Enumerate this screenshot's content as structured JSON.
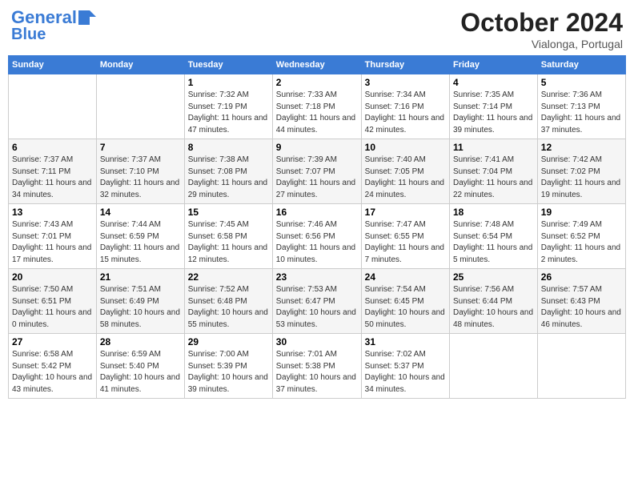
{
  "header": {
    "logo_line1": "General",
    "logo_line2": "Blue",
    "month": "October 2024",
    "location": "Vialonga, Portugal"
  },
  "days_of_week": [
    "Sunday",
    "Monday",
    "Tuesday",
    "Wednesday",
    "Thursday",
    "Friday",
    "Saturday"
  ],
  "weeks": [
    [
      {
        "day": "",
        "sunrise": "",
        "sunset": "",
        "daylight": ""
      },
      {
        "day": "",
        "sunrise": "",
        "sunset": "",
        "daylight": ""
      },
      {
        "day": "1",
        "sunrise": "Sunrise: 7:32 AM",
        "sunset": "Sunset: 7:19 PM",
        "daylight": "Daylight: 11 hours and 47 minutes."
      },
      {
        "day": "2",
        "sunrise": "Sunrise: 7:33 AM",
        "sunset": "Sunset: 7:18 PM",
        "daylight": "Daylight: 11 hours and 44 minutes."
      },
      {
        "day": "3",
        "sunrise": "Sunrise: 7:34 AM",
        "sunset": "Sunset: 7:16 PM",
        "daylight": "Daylight: 11 hours and 42 minutes."
      },
      {
        "day": "4",
        "sunrise": "Sunrise: 7:35 AM",
        "sunset": "Sunset: 7:14 PM",
        "daylight": "Daylight: 11 hours and 39 minutes."
      },
      {
        "day": "5",
        "sunrise": "Sunrise: 7:36 AM",
        "sunset": "Sunset: 7:13 PM",
        "daylight": "Daylight: 11 hours and 37 minutes."
      }
    ],
    [
      {
        "day": "6",
        "sunrise": "Sunrise: 7:37 AM",
        "sunset": "Sunset: 7:11 PM",
        "daylight": "Daylight: 11 hours and 34 minutes."
      },
      {
        "day": "7",
        "sunrise": "Sunrise: 7:37 AM",
        "sunset": "Sunset: 7:10 PM",
        "daylight": "Daylight: 11 hours and 32 minutes."
      },
      {
        "day": "8",
        "sunrise": "Sunrise: 7:38 AM",
        "sunset": "Sunset: 7:08 PM",
        "daylight": "Daylight: 11 hours and 29 minutes."
      },
      {
        "day": "9",
        "sunrise": "Sunrise: 7:39 AM",
        "sunset": "Sunset: 7:07 PM",
        "daylight": "Daylight: 11 hours and 27 minutes."
      },
      {
        "day": "10",
        "sunrise": "Sunrise: 7:40 AM",
        "sunset": "Sunset: 7:05 PM",
        "daylight": "Daylight: 11 hours and 24 minutes."
      },
      {
        "day": "11",
        "sunrise": "Sunrise: 7:41 AM",
        "sunset": "Sunset: 7:04 PM",
        "daylight": "Daylight: 11 hours and 22 minutes."
      },
      {
        "day": "12",
        "sunrise": "Sunrise: 7:42 AM",
        "sunset": "Sunset: 7:02 PM",
        "daylight": "Daylight: 11 hours and 19 minutes."
      }
    ],
    [
      {
        "day": "13",
        "sunrise": "Sunrise: 7:43 AM",
        "sunset": "Sunset: 7:01 PM",
        "daylight": "Daylight: 11 hours and 17 minutes."
      },
      {
        "day": "14",
        "sunrise": "Sunrise: 7:44 AM",
        "sunset": "Sunset: 6:59 PM",
        "daylight": "Daylight: 11 hours and 15 minutes."
      },
      {
        "day": "15",
        "sunrise": "Sunrise: 7:45 AM",
        "sunset": "Sunset: 6:58 PM",
        "daylight": "Daylight: 11 hours and 12 minutes."
      },
      {
        "day": "16",
        "sunrise": "Sunrise: 7:46 AM",
        "sunset": "Sunset: 6:56 PM",
        "daylight": "Daylight: 11 hours and 10 minutes."
      },
      {
        "day": "17",
        "sunrise": "Sunrise: 7:47 AM",
        "sunset": "Sunset: 6:55 PM",
        "daylight": "Daylight: 11 hours and 7 minutes."
      },
      {
        "day": "18",
        "sunrise": "Sunrise: 7:48 AM",
        "sunset": "Sunset: 6:54 PM",
        "daylight": "Daylight: 11 hours and 5 minutes."
      },
      {
        "day": "19",
        "sunrise": "Sunrise: 7:49 AM",
        "sunset": "Sunset: 6:52 PM",
        "daylight": "Daylight: 11 hours and 2 minutes."
      }
    ],
    [
      {
        "day": "20",
        "sunrise": "Sunrise: 7:50 AM",
        "sunset": "Sunset: 6:51 PM",
        "daylight": "Daylight: 11 hours and 0 minutes."
      },
      {
        "day": "21",
        "sunrise": "Sunrise: 7:51 AM",
        "sunset": "Sunset: 6:49 PM",
        "daylight": "Daylight: 10 hours and 58 minutes."
      },
      {
        "day": "22",
        "sunrise": "Sunrise: 7:52 AM",
        "sunset": "Sunset: 6:48 PM",
        "daylight": "Daylight: 10 hours and 55 minutes."
      },
      {
        "day": "23",
        "sunrise": "Sunrise: 7:53 AM",
        "sunset": "Sunset: 6:47 PM",
        "daylight": "Daylight: 10 hours and 53 minutes."
      },
      {
        "day": "24",
        "sunrise": "Sunrise: 7:54 AM",
        "sunset": "Sunset: 6:45 PM",
        "daylight": "Daylight: 10 hours and 50 minutes."
      },
      {
        "day": "25",
        "sunrise": "Sunrise: 7:56 AM",
        "sunset": "Sunset: 6:44 PM",
        "daylight": "Daylight: 10 hours and 48 minutes."
      },
      {
        "day": "26",
        "sunrise": "Sunrise: 7:57 AM",
        "sunset": "Sunset: 6:43 PM",
        "daylight": "Daylight: 10 hours and 46 minutes."
      }
    ],
    [
      {
        "day": "27",
        "sunrise": "Sunrise: 6:58 AM",
        "sunset": "Sunset: 5:42 PM",
        "daylight": "Daylight: 10 hours and 43 minutes."
      },
      {
        "day": "28",
        "sunrise": "Sunrise: 6:59 AM",
        "sunset": "Sunset: 5:40 PM",
        "daylight": "Daylight: 10 hours and 41 minutes."
      },
      {
        "day": "29",
        "sunrise": "Sunrise: 7:00 AM",
        "sunset": "Sunset: 5:39 PM",
        "daylight": "Daylight: 10 hours and 39 minutes."
      },
      {
        "day": "30",
        "sunrise": "Sunrise: 7:01 AM",
        "sunset": "Sunset: 5:38 PM",
        "daylight": "Daylight: 10 hours and 37 minutes."
      },
      {
        "day": "31",
        "sunrise": "Sunrise: 7:02 AM",
        "sunset": "Sunset: 5:37 PM",
        "daylight": "Daylight: 10 hours and 34 minutes."
      },
      {
        "day": "",
        "sunrise": "",
        "sunset": "",
        "daylight": ""
      },
      {
        "day": "",
        "sunrise": "",
        "sunset": "",
        "daylight": ""
      }
    ]
  ]
}
